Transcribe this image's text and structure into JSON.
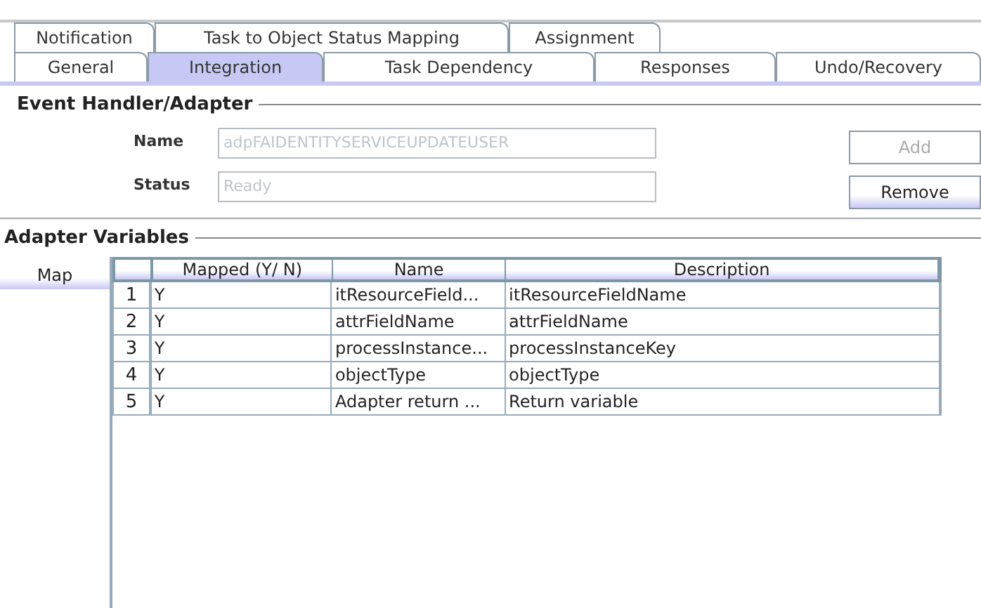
{
  "tabs_row_1": [
    {
      "label": "Notification",
      "selected": false
    },
    {
      "label": "Task to Object Status Mapping",
      "selected": false
    },
    {
      "label": "Assignment",
      "selected": false
    }
  ],
  "tabs_row_2": [
    {
      "label": "General",
      "selected": false
    },
    {
      "label": "Integration",
      "selected": true
    },
    {
      "label": "Task Dependency",
      "selected": false
    },
    {
      "label": "Responses",
      "selected": false
    },
    {
      "label": "Undo/Recovery",
      "selected": false
    }
  ],
  "event_handler": {
    "title": "Event Handler/Adapter",
    "fields": [
      {
        "label": "Name",
        "value": "adpFAIDENTITYSERVICEUPDATEUSER",
        "disabled": true
      },
      {
        "label": "Status",
        "value": "Ready",
        "disabled": true
      }
    ],
    "buttons": [
      {
        "label": "Add",
        "disabled": true
      },
      {
        "label": "Remove",
        "disabled": false
      }
    ]
  },
  "adapter_variables": {
    "title": "Adapter Variables",
    "map_button": "Map",
    "columns": [
      "Mapped (Y/ N)",
      "Name",
      "Description"
    ],
    "rows": [
      {
        "index": "1",
        "cells": [
          "Y",
          "itResourceField...",
          "itResourceFieldName"
        ]
      },
      {
        "index": "2",
        "cells": [
          "Y",
          "attrFieldName",
          "attrFieldName"
        ]
      },
      {
        "index": "3",
        "cells": [
          "Y",
          "processInstance...",
          "processInstanceKey"
        ]
      },
      {
        "index": "4",
        "cells": [
          "Y",
          "objectType",
          "objectType"
        ]
      },
      {
        "index": "5",
        "cells": [
          "Y",
          "Adapter return ...",
          "Return variable"
        ]
      }
    ]
  }
}
